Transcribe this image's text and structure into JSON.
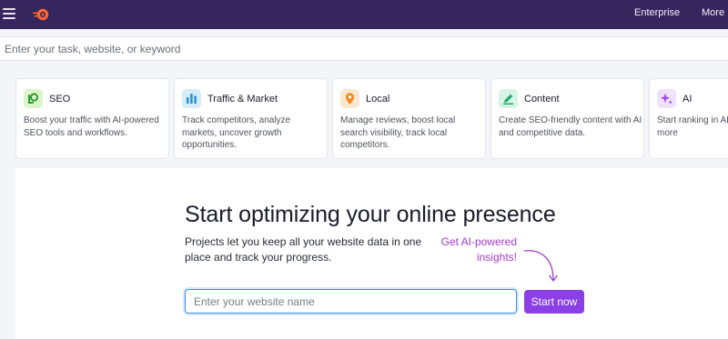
{
  "topbar": {
    "enterprise_label": "Enterprise",
    "more_label": "More",
    "background": "#35265e"
  },
  "search": {
    "placeholder": "Enter your task, website, or keyword"
  },
  "cards": [
    {
      "icon": "seo-icon",
      "title": "SEO",
      "description": "Boost your traffic with AI-powered SEO tools and workflows.",
      "icon_bg": "#dcf5c9"
    },
    {
      "icon": "bar-chart-icon",
      "title": "Traffic & Market",
      "description": "Track competitors, analyze markets, uncover growth opportunities.",
      "icon_bg": "#d7ecfb"
    },
    {
      "icon": "map-pin-icon",
      "title": "Local",
      "description": "Manage reviews, boost local search visibility, track local competitors.",
      "icon_bg": "#fde7cf"
    },
    {
      "icon": "pencil-icon",
      "title": "Content",
      "description": "Create SEO-friendly content with AI and competitive data.",
      "icon_bg": "#d6f3e4"
    },
    {
      "icon": "sparkle-icon",
      "title": "AI",
      "description": "Start ranking in AI ChatGPT and more",
      "icon_bg": "#efe2fb"
    }
  ],
  "main": {
    "headline": "Start optimizing your online presence",
    "subtext": "Projects let you keep all your website data in one place and track your progress.",
    "ai_note": "Get AI-powered insights!",
    "website_input_placeholder": "Enter your website name",
    "start_button_label": "Start now",
    "accent": "#8b3fe6"
  }
}
